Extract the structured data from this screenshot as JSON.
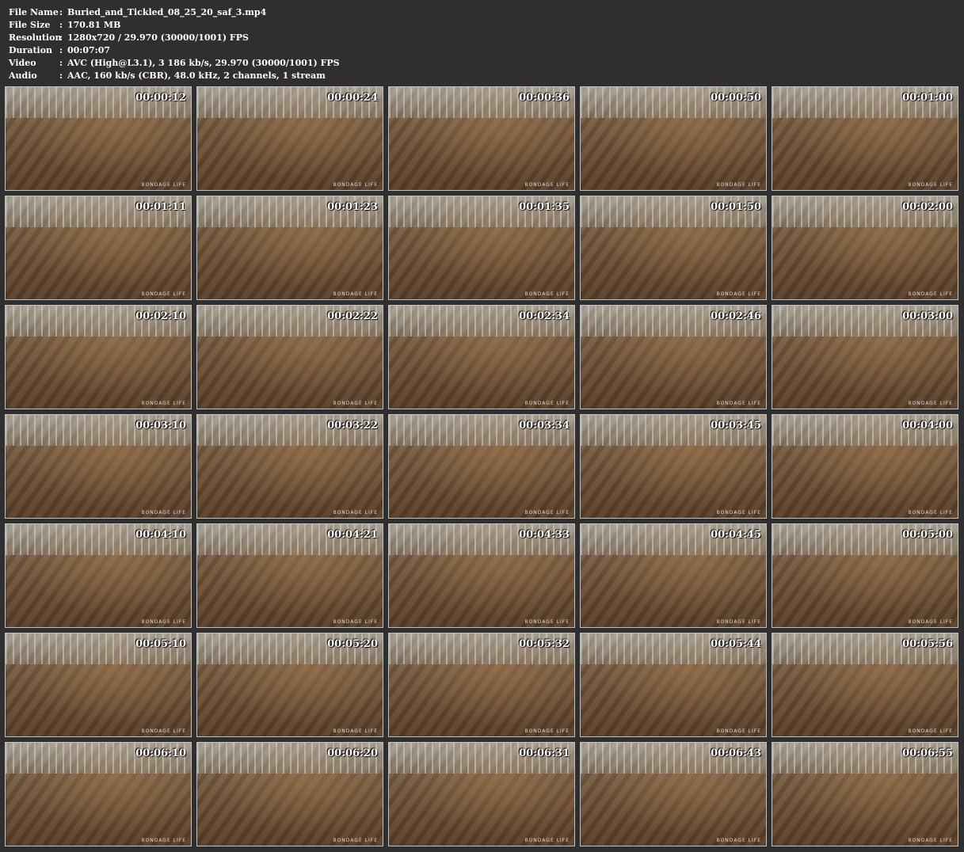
{
  "info": [
    {
      "key": "File Name",
      "value": "Buried_and_Tickled_08_25_20_saf_3.mp4"
    },
    {
      "key": "File Size",
      "value": "170.81 MB"
    },
    {
      "key": "Resolution",
      "value": "1280x720 / 29.970 (30000/1001) FPS"
    },
    {
      "key": "Duration",
      "value": "00:07:07"
    },
    {
      "key": "Video",
      "value": "AVC (High@L3.1), 3 186 kb/s, 29.970 (30000/1001) FPS"
    },
    {
      "key": "Audio",
      "value": "AAC, 160 kb/s (CBR), 48.0 kHz, 2 channels, 1 stream"
    }
  ],
  "separator": ":",
  "watermark": "BONDAGE LIFE",
  "thumbnails": [
    "00:00:12",
    "00:00:24",
    "00:00:36",
    "00:00:50",
    "00:01:00",
    "00:01:11",
    "00:01:23",
    "00:01:35",
    "00:01:50",
    "00:02:00",
    "00:02:10",
    "00:02:22",
    "00:02:34",
    "00:02:46",
    "00:03:00",
    "00:03:10",
    "00:03:22",
    "00:03:34",
    "00:03:45",
    "00:04:00",
    "00:04:10",
    "00:04:21",
    "00:04:33",
    "00:04:45",
    "00:05:00",
    "00:05:10",
    "00:05:20",
    "00:05:32",
    "00:05:44",
    "00:05:56",
    "00:06:10",
    "00:06:20",
    "00:06:31",
    "00:06:43",
    "00:06:55"
  ]
}
